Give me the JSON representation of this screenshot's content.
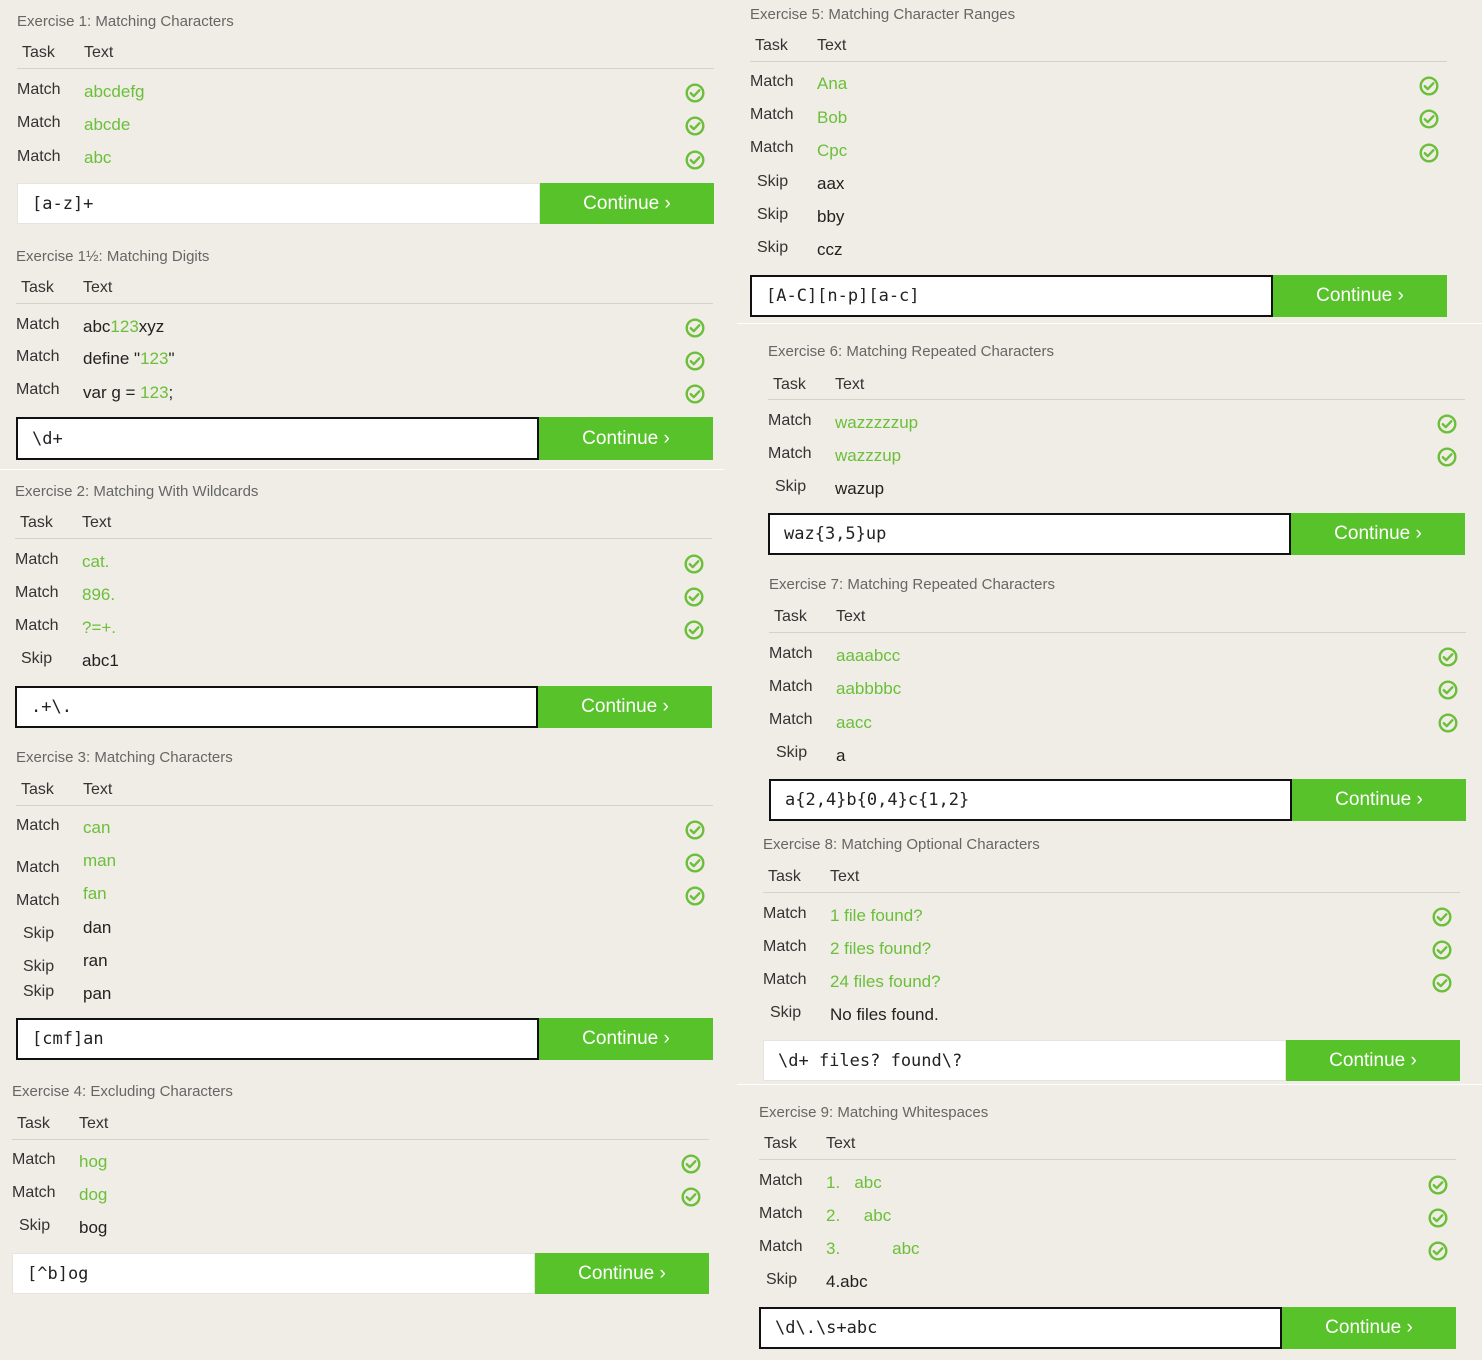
{
  "labels": {
    "task": "Task",
    "text": "Text",
    "match": "Match",
    "skip": "Skip",
    "continue": "Continue ›"
  },
  "exercises": {
    "e1": {
      "title": "Exercise 1: Matching Characters",
      "rows": [
        [
          "Match",
          "abcdefg"
        ],
        [
          "Match",
          "abcde"
        ],
        [
          "Match",
          "abc"
        ]
      ],
      "input": "[a-z]+"
    },
    "e15": {
      "title": "Exercise 1½: Matching Digits",
      "rows": [
        [
          "Match",
          "abc123xyz"
        ],
        [
          "Match",
          "define \"123\""
        ],
        [
          "Match",
          "var g = 123;"
        ]
      ],
      "input": "\\d+"
    },
    "e2": {
      "title": "Exercise 2: Matching With Wildcards",
      "rows": [
        [
          "Match",
          "cat."
        ],
        [
          "Match",
          "896."
        ],
        [
          "Match",
          "?=+."
        ],
        [
          "Skip",
          "abc1"
        ]
      ],
      "input": ".+\\."
    },
    "e3": {
      "title": "Exercise 3: Matching Characters",
      "rows": [
        [
          "Match",
          "can"
        ],
        [
          "Match",
          "man"
        ],
        [
          "Match",
          "fan"
        ],
        [
          "Skip",
          "dan"
        ],
        [
          "Skip",
          "ran"
        ],
        [
          "Skip",
          "pan"
        ]
      ],
      "input": "[cmf]an"
    },
    "e4": {
      "title": "Exercise 4: Excluding Characters",
      "rows": [
        [
          "Match",
          "hog"
        ],
        [
          "Match",
          "dog"
        ],
        [
          "Skip",
          "bog"
        ]
      ],
      "input": "[^b]og"
    },
    "e5": {
      "title": "Exercise 5: Matching Character Ranges",
      "rows": [
        [
          "Match",
          "Ana"
        ],
        [
          "Match",
          "Bob"
        ],
        [
          "Match",
          "Cpc"
        ],
        [
          "Skip",
          "aax"
        ],
        [
          "Skip",
          "bby"
        ],
        [
          "Skip",
          "ccz"
        ]
      ],
      "input": "[A-C][n-p][a-c]"
    },
    "e6": {
      "title": "Exercise 6: Matching Repeated Characters",
      "rows": [
        [
          "Match",
          "wazzzzzup"
        ],
        [
          "Match",
          "wazzzup"
        ],
        [
          "Skip",
          "wazup"
        ]
      ],
      "input": "waz{3,5}up"
    },
    "e7": {
      "title": "Exercise 7: Matching Repeated Characters",
      "rows": [
        [
          "Match",
          "aaaabcc"
        ],
        [
          "Match",
          "aabbbbc"
        ],
        [
          "Match",
          "aacc"
        ],
        [
          "Skip",
          "a"
        ]
      ],
      "input": "a{2,4}b{0,4}c{1,2}"
    },
    "e8": {
      "title": "Exercise 8: Matching Optional Characters",
      "rows": [
        [
          "Match",
          "1 file found?"
        ],
        [
          "Match",
          "2 files found?"
        ],
        [
          "Match",
          "24 files found?"
        ],
        [
          "Skip",
          "No files found."
        ]
      ],
      "input": "\\d+ files? found\\?"
    },
    "e9": {
      "title": "Exercise 9: Matching Whitespaces",
      "rows": [
        [
          "Match",
          "1.   abc"
        ],
        [
          "Match",
          "2.     abc"
        ],
        [
          "Match",
          "3.           abc"
        ],
        [
          "Skip",
          "4.abc"
        ]
      ],
      "input": "\\d\\.\\s+abc"
    }
  },
  "partials": {
    "e15_r0": [
      "abc",
      "123",
      "xyz"
    ],
    "e15_r1": [
      "define \"",
      "123",
      "\""
    ],
    "e15_r2": [
      "var g = ",
      "123",
      ";"
    ]
  },
  "colors": {
    "accent": "#58c22a",
    "matched_text": "#6bbf3a",
    "background": "#efede5"
  },
  "icons": {
    "check": "check-circle-icon"
  }
}
